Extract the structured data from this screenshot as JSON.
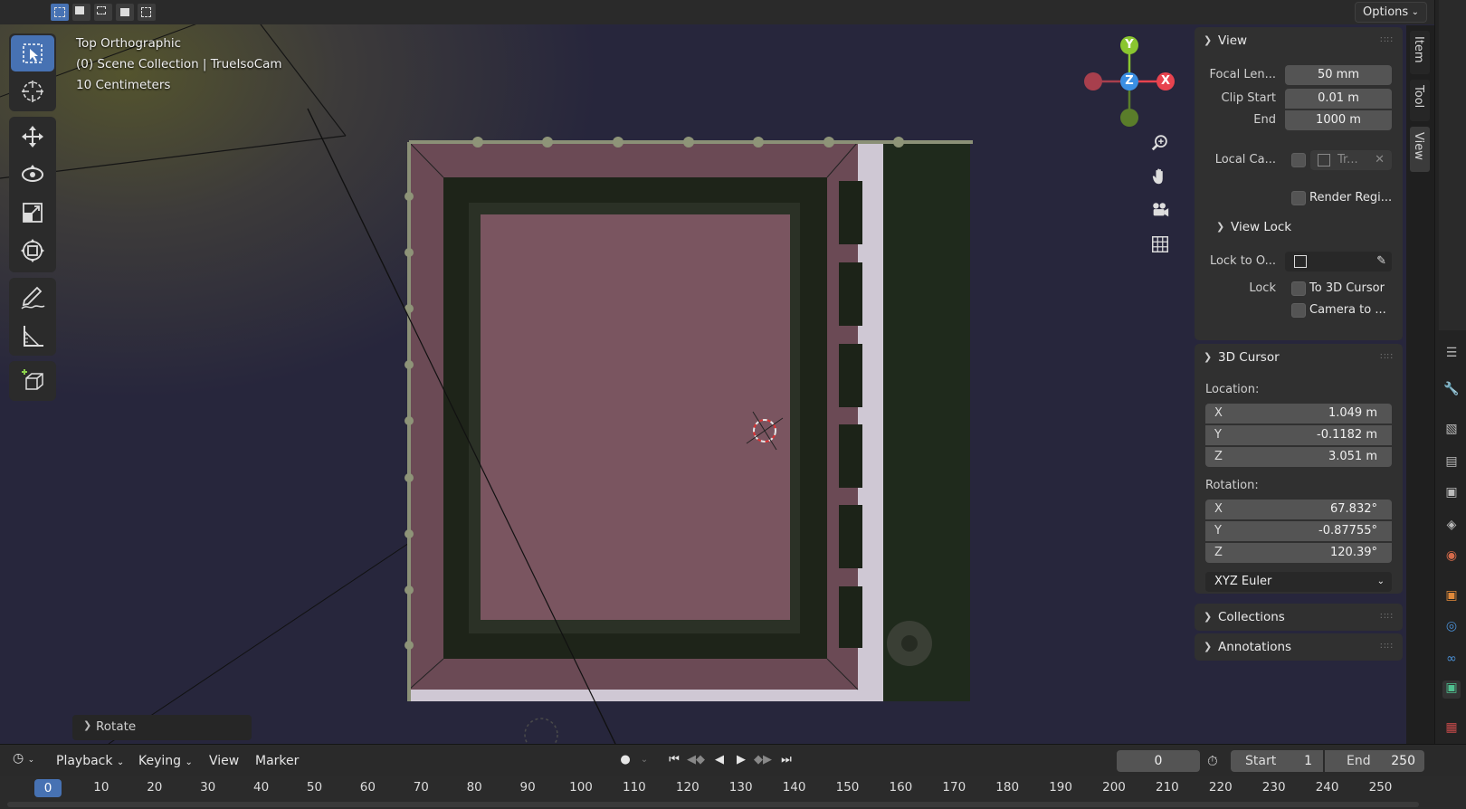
{
  "header": {
    "options_label": "Options",
    "select_modes": [
      "select-box-new",
      "select-box-extend",
      "select-box-subtract",
      "select-box-invert"
    ]
  },
  "overlay": {
    "view_name": "Top Orthographic",
    "collection": "(0) Scene Collection | TrueIsoCam",
    "scale": "10 Centimeters"
  },
  "toolbar": {
    "tools": [
      "select-box",
      "cursor",
      "move",
      "rotate",
      "scale",
      "transform",
      "annotate",
      "measure",
      "add-cube"
    ],
    "active_tool": "select-box"
  },
  "gizmo": {
    "x_label": "X",
    "y_label": "Y",
    "z_label": "Z",
    "colors": {
      "x": "#e8434f",
      "y": "#8ac630",
      "z": "#3b8fe3",
      "neg_x": "#a83f4d",
      "neg_y": "#5a7d2a"
    }
  },
  "side_tabs": [
    "Item",
    "Tool",
    "View"
  ],
  "active_side_tab": "View",
  "view_panel": {
    "title": "View",
    "focal_label": "Focal Len...",
    "focal_value": "50 mm",
    "clip_start_label": "Clip Start",
    "clip_start_value": "0.01 m",
    "clip_end_label": "End",
    "clip_end_value": "1000 m",
    "local_camera_label": "Local Ca...",
    "local_camera_value": "Tr...",
    "render_region_label": "Render Regi...",
    "view_lock": {
      "title": "View Lock",
      "lock_object_label": "Lock to O...",
      "lock_label": "Lock",
      "to_3d_cursor": "To 3D Cursor",
      "camera_to": "Camera to ..."
    }
  },
  "cursor_panel": {
    "title": "3D Cursor",
    "location_label": "Location:",
    "location": [
      {
        "axis": "X",
        "value": "1.049 m"
      },
      {
        "axis": "Y",
        "value": "-0.1182 m"
      },
      {
        "axis": "Z",
        "value": "3.051 m"
      }
    ],
    "rotation_label": "Rotation:",
    "rotation": [
      {
        "axis": "X",
        "value": "67.832°"
      },
      {
        "axis": "Y",
        "value": "-0.87755°"
      },
      {
        "axis": "Z",
        "value": "120.39°"
      }
    ],
    "rotation_mode": "XYZ Euler"
  },
  "collapsed_panels": [
    "Collections",
    "Annotations"
  ],
  "operator_panel": {
    "label": "Rotate"
  },
  "timeline": {
    "menus": [
      "Playback",
      "Keying",
      "View",
      "Marker"
    ],
    "current_frame": "0",
    "start_label": "Start",
    "start_value": "1",
    "end_label": "End",
    "end_value": "250",
    "ticks": [
      "0",
      "10",
      "20",
      "30",
      "40",
      "50",
      "60",
      "70",
      "80",
      "90",
      "100",
      "110",
      "120",
      "130",
      "140",
      "150",
      "160",
      "170",
      "180",
      "190",
      "200",
      "210",
      "220",
      "230",
      "240",
      "250"
    ]
  }
}
